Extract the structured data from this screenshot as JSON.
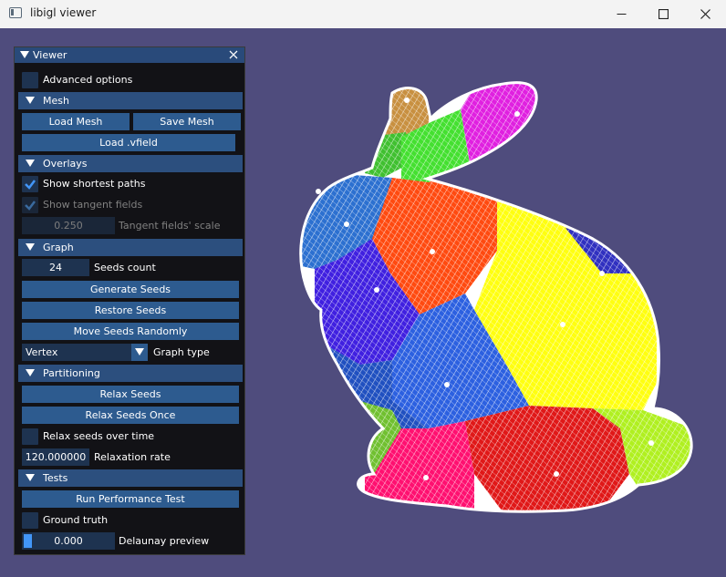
{
  "window": {
    "title": "libigl viewer",
    "icon": "app-icon",
    "controls": [
      "minimize-icon",
      "maximize-icon",
      "close-icon"
    ]
  },
  "colors": {
    "viewport_bg": "#4f4c7d",
    "panel_bg": "#101012",
    "header_bg": "#2c4f7e",
    "button_bg": "#2d5b8f",
    "frame_bg": "#1e3350",
    "check_mark": "#4296f8"
  },
  "panel": {
    "title": "Viewer",
    "advanced_options": {
      "label": "Advanced options",
      "checked": false
    },
    "mesh": {
      "header": "Mesh",
      "load_mesh": "Load Mesh",
      "save_mesh": "Save Mesh",
      "load_vfield": "Load .vfield"
    },
    "overlays": {
      "header": "Overlays",
      "show_shortest_paths": {
        "label": "Show shortest paths",
        "checked": true
      },
      "show_tangent_fields": {
        "label": "Show tangent fields",
        "checked": true,
        "disabled": true
      },
      "tangent_scale": {
        "value": "0.250",
        "label": "Tangent fields' scale",
        "disabled": true
      }
    },
    "graph": {
      "header": "Graph",
      "seeds_count": {
        "value": "24",
        "label": "Seeds count"
      },
      "generate_seeds": "Generate Seeds",
      "restore_seeds": "Restore Seeds",
      "move_seeds_randomly": "Move Seeds Randomly",
      "graph_type": {
        "value": "Vertex",
        "label": "Graph type"
      }
    },
    "partitioning": {
      "header": "Partitioning",
      "relax_seeds": "Relax Seeds",
      "relax_seeds_once": "Relax Seeds Once",
      "relax_over_time": {
        "label": "Relax seeds over time",
        "checked": false
      },
      "relaxation_rate": {
        "value": "120.000000",
        "label": "Relaxation rate"
      }
    },
    "tests": {
      "header": "Tests",
      "run_performance_test": "Run Performance Test",
      "ground_truth": {
        "label": "Ground truth",
        "checked": false
      },
      "delaunay_preview": {
        "value": "0.000",
        "label": "Delaunay preview",
        "fraction": 0.0
      }
    }
  },
  "mesh_view": {
    "object": "bunny-mesh",
    "region_colors": [
      "#ff00ff",
      "#c89040",
      "#40e040",
      "#2060c0",
      "#ff4000",
      "#ffff00",
      "#3030e0",
      "#2858e0",
      "#ff1060",
      "#e01818",
      "#b0f020",
      "#60c020",
      "#101010"
    ]
  }
}
